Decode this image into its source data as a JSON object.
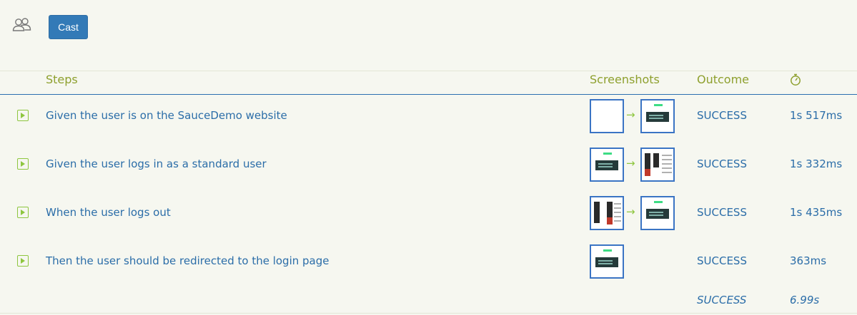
{
  "toolbar": {
    "cast_icon": "people-icon",
    "cast_label": "Cast"
  },
  "table": {
    "headers": {
      "steps": "Steps",
      "screenshots": "Screenshots",
      "outcome": "Outcome",
      "duration_icon": "stopwatch-icon"
    },
    "rows": [
      {
        "step": "Given the user is on the SauceDemo website",
        "outcome": "SUCCESS",
        "duration": "1s 517ms"
      },
      {
        "step": "Given the user logs in as a standard user",
        "outcome": "SUCCESS",
        "duration": "1s 332ms"
      },
      {
        "step": "When the user logs out",
        "outcome": "SUCCESS",
        "duration": "1s 435ms"
      },
      {
        "step": "Then the user should be redirected to the login page",
        "outcome": "SUCCESS",
        "duration": "363ms"
      }
    ],
    "total": {
      "outcome": "SUCCESS",
      "duration": "6.99s"
    }
  },
  "colors": {
    "background": "#f6f7f0",
    "header_text": "#8ea02e",
    "body_text": "#2b6da8",
    "accent_green": "#8ec63f",
    "button_blue": "#337ab7"
  }
}
